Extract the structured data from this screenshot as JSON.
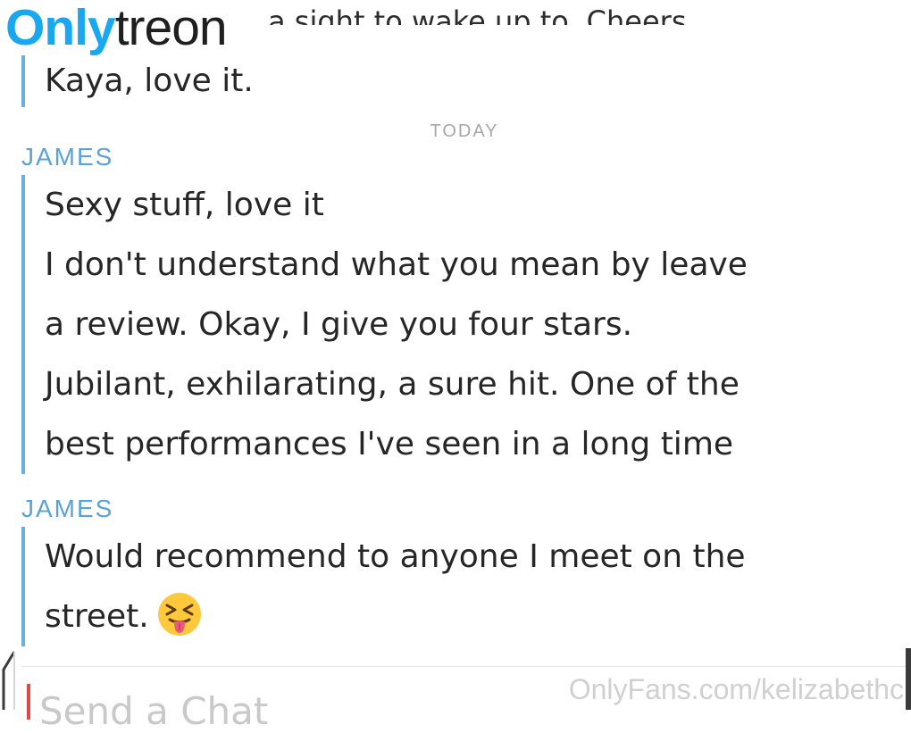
{
  "watermark_top": {
    "part1": "Only",
    "part2": "treon"
  },
  "chat": {
    "previous_message": {
      "cut_line": "a sight to wake up to. Cheers",
      "last_line": "Kaya, love it."
    },
    "day_separator": "TODAY",
    "messages": [
      {
        "sender": "JAMES",
        "lines": [
          "Sexy stuff, love it",
          "I don't understand what you mean by leave",
          "a review. Okay, I give you four stars.",
          "Jubilant, exhilarating, a sure hit. One of the",
          "best performances I've seen in a long time"
        ]
      },
      {
        "sender": "JAMES",
        "lines": [
          "Would recommend to anyone I meet on the",
          "street."
        ],
        "emoji": "squinting-face-with-tongue"
      }
    ],
    "composer": {
      "placeholder": "Send a Chat"
    }
  },
  "watermark_bottom": "OnlyFans.com/kelizabethc",
  "colors": {
    "accent_blue": "#5aa2d8",
    "bar_blue": "#6aaee2",
    "logo_blue": "#19a7f0",
    "cursor_red": "#e04848"
  }
}
